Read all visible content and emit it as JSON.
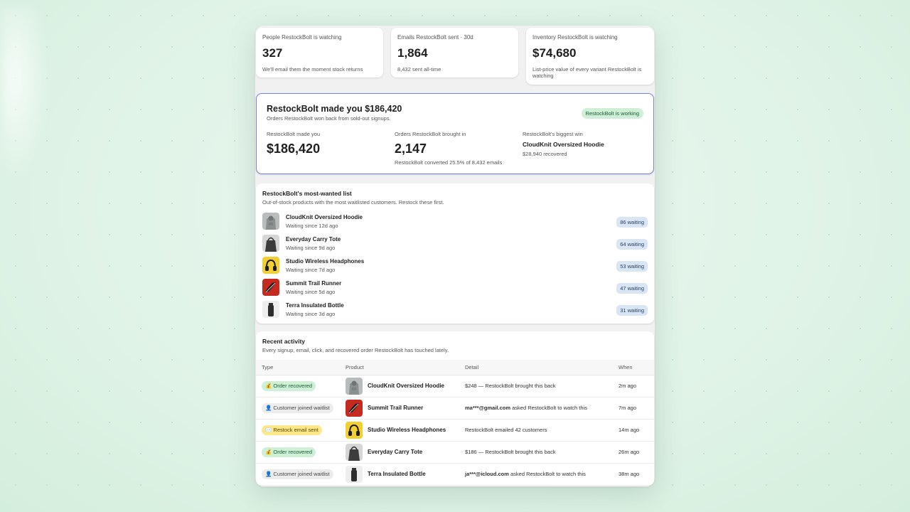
{
  "stats": [
    {
      "label": "People RestockBolt is watching",
      "value": "327",
      "sub": "We'll email them the moment stock returns"
    },
    {
      "label": "Emails RestockBolt sent · 30d",
      "value": "1,864",
      "sub": "8,432 sent all-time"
    },
    {
      "label": "Inventory RestockBolt is watching",
      "value": "$74,680",
      "sub": "List-price value of every variant RestockBolt is watching"
    }
  ],
  "hero": {
    "title": "RestockBolt made you $186,420",
    "subtitle": "Orders RestockBolt won back from sold-out signups.",
    "badge": "RestockBolt is working",
    "col1_label": "RestockBolt made you",
    "col1_value": "$186,420",
    "col2_label": "Orders RestockBolt brought in",
    "col2_value": "2,147",
    "col2_sub": "RestockBolt converted 25.5% of 8,432 emails",
    "col3_label": "RestockBolt's biggest win",
    "col3_product": "CloudKnit Oversized Hoodie",
    "col3_sub": "$28,940 recovered"
  },
  "wanted": {
    "title": "RestockBolt's most-wanted list",
    "subtitle": "Out-of-stock products with the most waitlisted customers. Restock these first.",
    "items": [
      {
        "name": "CloudKnit Oversized Hoodie",
        "since": "Waiting since 12d ago",
        "badge": "86 waiting",
        "thumb": "hoodie-thumbnail"
      },
      {
        "name": "Everyday Carry Tote",
        "since": "Waiting since 9d ago",
        "badge": "64 waiting",
        "thumb": "tote-thumbnail"
      },
      {
        "name": "Studio Wireless Headphones",
        "since": "Waiting since 7d ago",
        "badge": "53 waiting",
        "thumb": "headphones-thumbnail"
      },
      {
        "name": "Summit Trail Runner",
        "since": "Waiting since 5d ago",
        "badge": "47 waiting",
        "thumb": "shoe-thumbnail"
      },
      {
        "name": "Terra Insulated Bottle",
        "since": "Waiting since 3d ago",
        "badge": "31 waiting",
        "thumb": "bottle-thumbnail"
      }
    ]
  },
  "activity": {
    "title": "Recent activity",
    "subtitle": "Every signup, email, click, and recovered order RestockBolt has touched lately.",
    "columns": [
      "Type",
      "Product",
      "Detail",
      "When"
    ],
    "rows": [
      {
        "type": "💰 Order recovered",
        "product": "CloudKnit Oversized Hoodie",
        "detail_strong": "",
        "detail": "$248 — RestockBolt brought this back",
        "when": "2m ago"
      },
      {
        "type": "👤 Customer joined waitlist",
        "product": "Summit Trail Runner",
        "detail_strong": "ma***@gmail.com",
        "detail": " asked RestockBolt to watch this",
        "when": "7m ago"
      },
      {
        "type": "✉️ Restock email sent",
        "product": "Studio Wireless Headphones",
        "detail_strong": "",
        "detail": "RestockBolt emailed 42 customers",
        "when": "14m ago"
      },
      {
        "type": "💰 Order recovered",
        "product": "Everyday Carry Tote",
        "detail_strong": "",
        "detail": "$186 — RestockBolt brought this back",
        "when": "26m ago"
      },
      {
        "type": "👤 Customer joined waitlist",
        "product": "Terra Insulated Bottle",
        "detail_strong": "ja***@icloud.com",
        "detail": " asked RestockBolt to watch this",
        "when": "38m ago"
      }
    ]
  }
}
